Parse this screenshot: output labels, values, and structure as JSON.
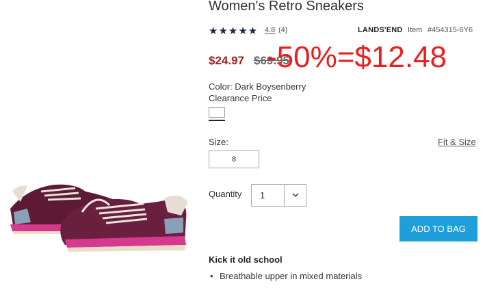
{
  "product": {
    "title": "Women's Retro Sneakers",
    "rating": {
      "stars": "★★★★★",
      "value": "4.8",
      "count": "(4)"
    },
    "brand": "LANDS'END",
    "item_label": "Item",
    "item_number": "#454315-6Y6"
  },
  "pricing": {
    "sale_price": "$24.97",
    "original_price": "$69.95",
    "annotation": "-50%=$12.48",
    "annotation_color": "#ee1c1c",
    "sale_color": "#a31e22"
  },
  "color": {
    "label": "Color: Dark Boysenberry",
    "price_note": "Clearance Price"
  },
  "size": {
    "label": "Size:",
    "fit_link": "Fit & Size",
    "selected": "8"
  },
  "quantity": {
    "label": "Quantity",
    "value": "1",
    "icon": "chevron-down-icon"
  },
  "cta": {
    "add_to_bag": "ADD TO BAG",
    "color": "#1e9fd9"
  },
  "description": {
    "heading": "Kick it old school",
    "bullets": [
      "Breathable upper in mixed materials"
    ]
  }
}
